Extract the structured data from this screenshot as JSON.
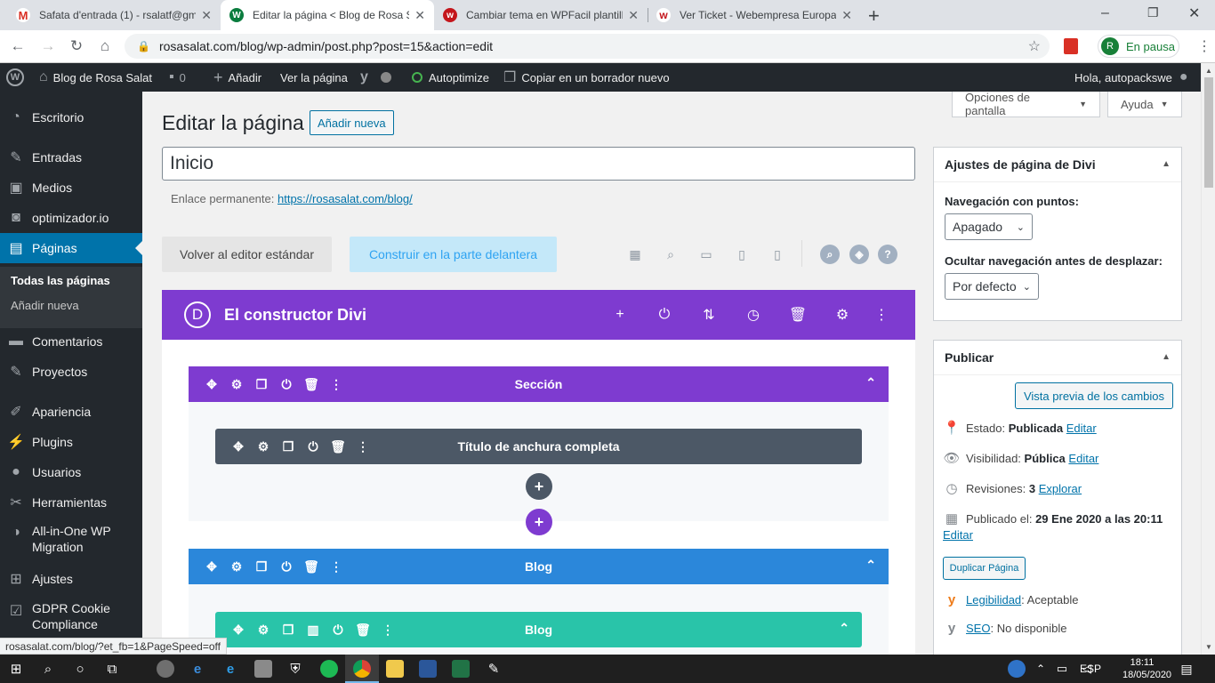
{
  "browser": {
    "tabs": [
      {
        "title": "Safata d'entrada (1) - rsalatf@gm",
        "icon": "gmail-icon",
        "close": "✕"
      },
      {
        "title": "Editar la página < Blog de Rosa S",
        "icon": "wordpress-icon",
        "close": "✕"
      },
      {
        "title": "Cambiar tema en WPFacil plantill",
        "icon": "webempresa-icon",
        "close": "✕"
      },
      {
        "title": "Ver Ticket - Webempresa Europa",
        "icon": "webempresa-icon",
        "close": "✕"
      }
    ],
    "new_tab": "+",
    "url": "rosasalat.com/blog/wp-admin/post.php?post=15&action=edit",
    "profile_initial": "R",
    "profile_status": "En pausa",
    "window_controls": [
      "–",
      "❐",
      "✕"
    ]
  },
  "adminbar": {
    "site_name": "Blog de Rosa Salat",
    "comments_count": "0",
    "add_new": "Añadir",
    "view_page": "Ver la página",
    "autoptimize": "Autoptimize",
    "copy_draft": "Copiar en un borrador nuevo",
    "greeting": "Hola, autopackswe"
  },
  "sidebar": {
    "items": [
      {
        "label": "Escritorio",
        "icon": "dashboard-icon"
      },
      {
        "label": "Entradas",
        "icon": "pin-icon"
      },
      {
        "label": "Medios",
        "icon": "media-icon"
      },
      {
        "label": "optimizador.io",
        "icon": "optimizador-icon"
      },
      {
        "label": "Páginas",
        "icon": "pages-icon"
      },
      {
        "label": "Comentarios",
        "icon": "comment-icon"
      },
      {
        "label": "Proyectos",
        "icon": "pin-icon"
      },
      {
        "label": "Apariencia",
        "icon": "brush-icon"
      },
      {
        "label": "Plugins",
        "icon": "plugin-icon"
      },
      {
        "label": "Usuarios",
        "icon": "user-icon"
      },
      {
        "label": "Herramientas",
        "icon": "wrench-icon"
      },
      {
        "label": "All-in-One WP",
        "label2": "Migration",
        "icon": "migration-icon"
      },
      {
        "label": "Ajustes",
        "icon": "settings-icon"
      },
      {
        "label": "GDPR Cookie",
        "label2": "Compliance",
        "icon": "check-icon"
      }
    ],
    "submenu": [
      "Todas las páginas",
      "Añadir nueva"
    ]
  },
  "main": {
    "screen_options": "Opciones de pantalla",
    "help": "Ayuda",
    "page_title": "Editar la página",
    "add_new": "Añadir nueva",
    "post_title": "Inicio",
    "permalink_label": "Enlace permanente:",
    "permalink_url": "https://rosasalat.com/blog/",
    "back_standard": "Volver al editor estándar",
    "build_front": "Construir en la parte delantera"
  },
  "divi": {
    "header_title": "El constructor Divi",
    "logo_letter": "D",
    "section_label": "Sección",
    "fullwidth_title": "Título de anchura completa",
    "blog_section": "Blog",
    "blog_row": "Blog",
    "colors": {
      "purple": "#7e3bd0",
      "gray": "#4c5866",
      "blue": "#2b87da",
      "teal": "#29c4a9"
    }
  },
  "divi_settings": {
    "title": "Ajustes de página de Divi",
    "dots_label": "Navegación con puntos:",
    "dots_value": "Apagado",
    "hide_label": "Ocultar navegación antes de desplazar:",
    "hide_value": "Por defecto"
  },
  "publish": {
    "title": "Publicar",
    "preview": "Vista previa de los cambios",
    "status_label": "Estado:",
    "status_value": "Publicada",
    "visibility_label": "Visibilidad:",
    "visibility_value": "Pública",
    "revisions_label": "Revisiones:",
    "revisions_value": "3",
    "explore": "Explorar",
    "published_label": "Publicado el:",
    "published_value": "29 Ene 2020 a las 20:11",
    "edit": "Editar",
    "duplicate": "Duplicar Página",
    "readability_label": "Legibilidad",
    "readability_value": ": Aceptable",
    "seo_label": "SEO",
    "seo_value": ": No disponible"
  },
  "statusbar": "rosasalat.com/blog/?et_fb=1&PageSpeed=off",
  "taskbar": {
    "lang": "ESP",
    "time": "18:11",
    "date": "18/05/2020"
  }
}
